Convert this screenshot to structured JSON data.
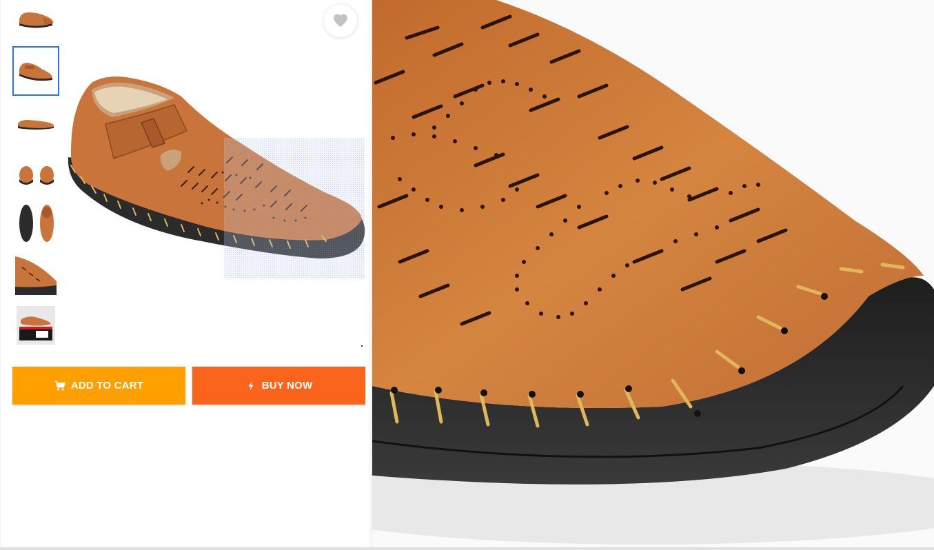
{
  "product": {
    "thumbnails": [
      {
        "name": "side-view",
        "active": false
      },
      {
        "name": "angle-view",
        "active": true
      },
      {
        "name": "profile-view",
        "active": false
      },
      {
        "name": "front-back-view",
        "active": false
      },
      {
        "name": "sole-view",
        "active": false
      },
      {
        "name": "closeup-view",
        "active": false
      },
      {
        "name": "packaging-view",
        "active": false
      }
    ]
  },
  "actions": {
    "add_to_cart": "ADD TO CART",
    "buy_now": "BUY NOW",
    "cart_icon": "cart-icon",
    "buy_icon": "lightning-icon",
    "wishlist_icon": "heart-icon"
  },
  "colors": {
    "add_to_cart": "#ff9f00",
    "buy_now": "#fb641b",
    "active_thumb_border": "#2874f0",
    "leather": "#c9743a",
    "sole": "#2b2b2b",
    "stitch": "#e0b85a"
  }
}
